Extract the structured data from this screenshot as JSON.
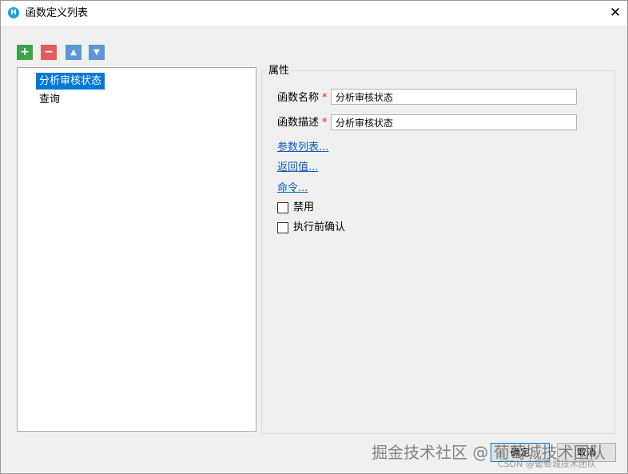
{
  "window": {
    "title": "函数定义列表",
    "app_icon": "app-logo-icon",
    "close_glyph": "✕"
  },
  "toolbar": {
    "add_glyph": "+",
    "remove_glyph": "−",
    "up_glyph": "▲",
    "down_glyph": "▼"
  },
  "tree": {
    "items": [
      {
        "label": "分析审核状态",
        "selected": true
      },
      {
        "label": "查询",
        "selected": false
      }
    ]
  },
  "properties": {
    "group_label": "属性",
    "name_label": "函数名称",
    "name_value": "分析审核状态",
    "desc_label": "函数描述",
    "desc_value": "分析审核状态",
    "required_mark": "*",
    "links": [
      "参数列表...",
      "返回值...",
      "命令..."
    ],
    "disabled_label": "禁用",
    "disabled_checked": false,
    "confirm_label": "执行前确认",
    "confirm_checked": false
  },
  "buttons": {
    "ok": "确定",
    "cancel": "取消"
  },
  "watermark": {
    "main": "掘金技术社区 @ 葡萄城技术团队",
    "sub": "CSDN @葡萄城技术团队"
  },
  "colors": {
    "selection": "#0078d7",
    "add": "#3fa34a",
    "remove": "#e35d5d",
    "move": "#5b97d3",
    "link": "#0b5bb8",
    "required": "#e02020"
  }
}
